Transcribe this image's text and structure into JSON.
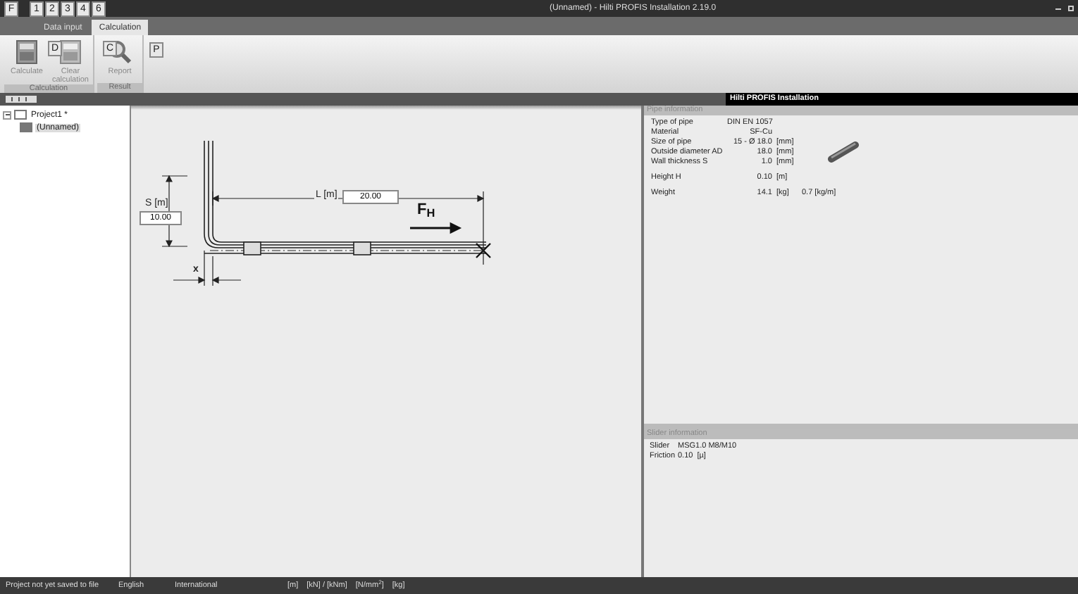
{
  "window": {
    "title": "(Unnamed) - Hilti PROFIS Installation 2.19.0"
  },
  "keytips": [
    {
      "label": "F"
    },
    {
      "label": "1"
    },
    {
      "label": "2"
    },
    {
      "label": "3"
    },
    {
      "label": "4"
    },
    {
      "label": "6"
    }
  ],
  "tabs": [
    {
      "label": "Data input",
      "selected": false,
      "keytip": "D"
    },
    {
      "label": "Calculation",
      "selected": true,
      "keytip": "C"
    }
  ],
  "extra_keytip": "P",
  "ribbon_groups": [
    {
      "title": "Calculation",
      "buttons": [
        {
          "label": "Calculate",
          "kind": "calculator",
          "disabled": true
        },
        {
          "label": "Clear calculation",
          "kind": "clear",
          "disabled": true
        }
      ]
    },
    {
      "title": "Result",
      "buttons": [
        {
          "label": "Report",
          "kind": "report",
          "disabled": true
        }
      ]
    }
  ],
  "brand_banner": "Hilti PROFIS Installation",
  "tree": [
    {
      "label": "Project1 *",
      "expanded": true,
      "children": [
        {
          "label": "(Unnamed)"
        }
      ]
    }
  ],
  "drawing": {
    "s_label": "S [m]",
    "s_value": "10.00",
    "l_label": "L [m]",
    "l_value": "20.00",
    "force_label": "F$_{H}$",
    "x_label": "x"
  },
  "pipe_info": {
    "title": "Pipe information",
    "groups": [
      [
        {
          "label": "Type of pipe",
          "value": "DIN EN 1057"
        },
        {
          "label": "Material",
          "value": "SF-Cu"
        },
        {
          "label": "Size of pipe",
          "value": "15 - Ø 18.0",
          "unit": "[mm]"
        },
        {
          "label": "Outside diameter AD",
          "value": "18.0",
          "unit": "[mm]"
        },
        {
          "label": "Wall thickness S",
          "value": "1.0",
          "unit": "[mm]"
        }
      ],
      [
        {
          "label": "Height H",
          "value": "0.10",
          "unit": "[m]"
        }
      ],
      [
        {
          "label": "Weight",
          "value": "14.1",
          "unit": "[kg]",
          "extra": "0.7 [kg/m]"
        }
      ]
    ]
  },
  "slider_info": {
    "title": "Slider information",
    "rows": [
      {
        "label": "Slider",
        "value": "MSG1.0 M8/M10"
      },
      {
        "label": "Friction",
        "value": "0.10",
        "unit": "[µ]"
      }
    ]
  },
  "status_bar": [
    "Project not yet saved to file",
    "English",
    "International",
    "[m]",
    "[kN] / [kNm]",
    "[N/mm$^{2}$]",
    "[kg]"
  ]
}
